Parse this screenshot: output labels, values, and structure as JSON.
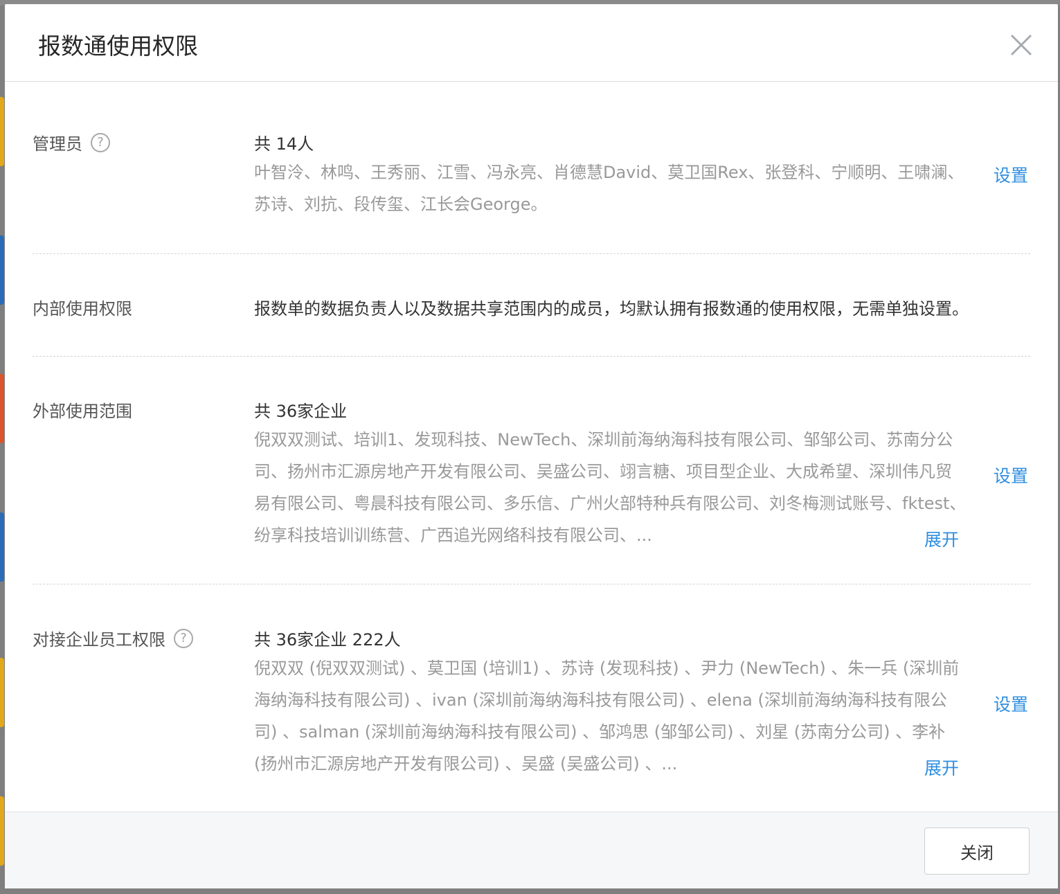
{
  "dialog": {
    "title": "报数通使用权限",
    "close_label": "关闭"
  },
  "admin": {
    "label": "管理员",
    "help_glyph": "?",
    "summary": "共 14人",
    "names": "叶智泠、林鸣、王秀丽、江雪、冯永亮、肖德慧David、莫卫国Rex、张登科、宁顺明、王啸澜、苏诗、刘抗、段传玺、江长会George。",
    "action": "设置"
  },
  "internal": {
    "label": "内部使用权限",
    "text": "报数单的数据负责人以及数据共享范围内的成员，均默认拥有报数通的使用权限，无需单独设置。"
  },
  "external": {
    "label": "外部使用范围",
    "summary": "共 36家企业",
    "names": "倪双双测试、培训1、发现科技、NewTech、深圳前海纳海科技有限公司、邹邹公司、苏南分公司、扬州市汇源房地产开发有限公司、吴盛公司、翊言糖、项目型企业、大成希望、深圳伟凡贸易有限公司、粤晨科技有限公司、多乐信、广州火部特种兵有限公司、刘冬梅测试账号、fktest、纷享科技培训训练营、广西追光网络科技有限公司、...",
    "action": "设置",
    "expand": "展开"
  },
  "partner": {
    "label": "对接企业员工权限",
    "help_glyph": "?",
    "summary": "共 36家企业 222人",
    "names": "倪双双 (倪双双测试) 、莫卫国 (培训1) 、苏诗 (发现科技) 、尹力 (NewTech) 、朱一兵 (深圳前海纳海科技有限公司) 、ivan (深圳前海纳海科技有限公司) 、elena (深圳前海纳海科技有限公司) 、salman (深圳前海纳海科技有限公司) 、邹鸿思 (邹邹公司) 、刘星 (苏南分公司) 、李补 (扬州市汇源房地产开发有限公司) 、吴盛 (吴盛公司) 、...",
    "action": "设置",
    "expand": "展开"
  },
  "colors": {
    "link": "#2e8ee0",
    "muted_text": "#999999",
    "primary_text": "#333333"
  }
}
